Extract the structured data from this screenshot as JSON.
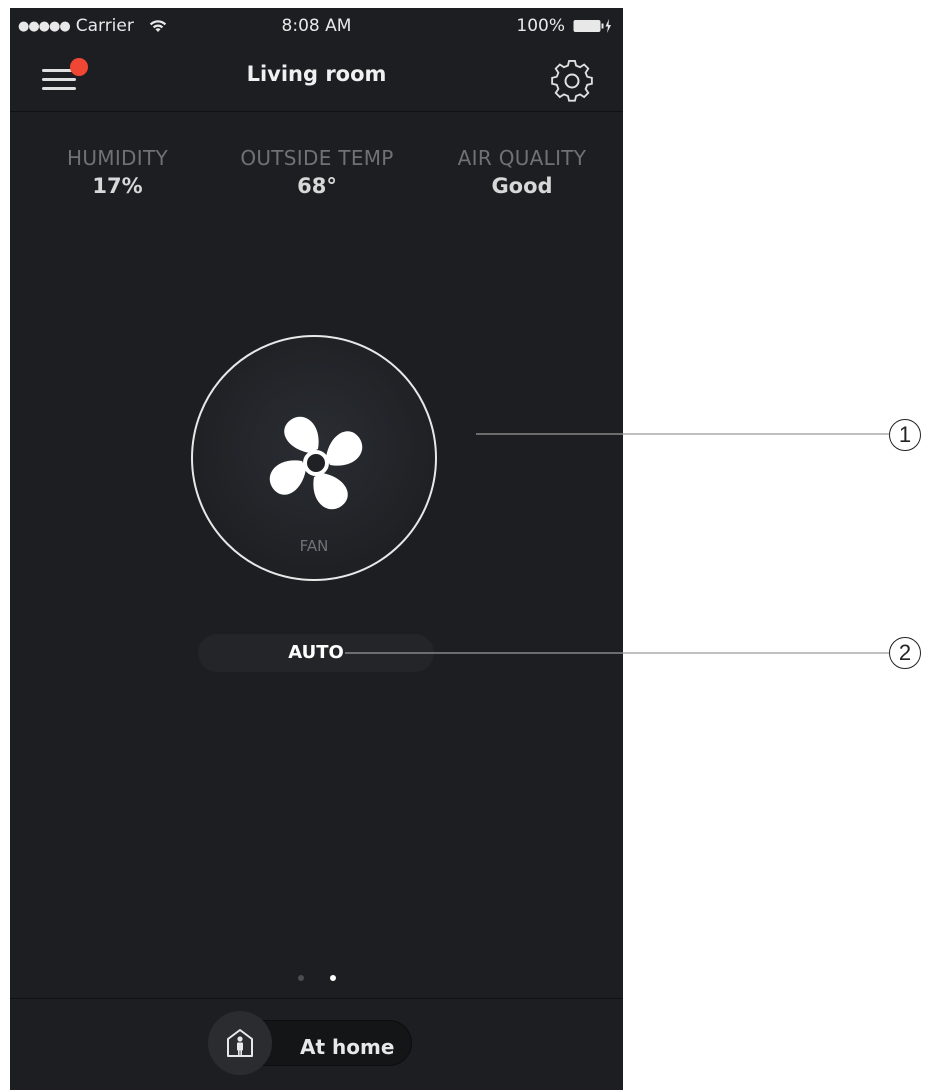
{
  "status_bar": {
    "carrier": "Carrier",
    "signal_dots": "●●●●●",
    "time": "8:08 AM",
    "battery": "100%",
    "icons": [
      "wifi-icon",
      "battery-icon",
      "charging-icon"
    ]
  },
  "header": {
    "title": "Living room",
    "menu_icon": "hamburger-menu-icon",
    "settings_icon": "gear-icon",
    "notification_color": "#ef4733"
  },
  "stats": [
    {
      "label": "HUMIDITY",
      "value": "17%"
    },
    {
      "label": "OUTSIDE TEMP",
      "value": "68°"
    },
    {
      "label": "AIR QUALITY",
      "value": "Good"
    }
  ],
  "fan": {
    "label": "FAN",
    "icon": "fan-icon"
  },
  "mode": {
    "label": "AUTO"
  },
  "pagination": {
    "count": 2,
    "active_index": 1
  },
  "footer": {
    "home_label": "At home",
    "home_icon": "home-person-icon"
  },
  "callouts": [
    "1",
    "2"
  ],
  "colors": {
    "background": "#1c1e21",
    "text_primary": "#ffffff",
    "text_muted": "#6e7277",
    "accent_notification": "#ef4733"
  }
}
